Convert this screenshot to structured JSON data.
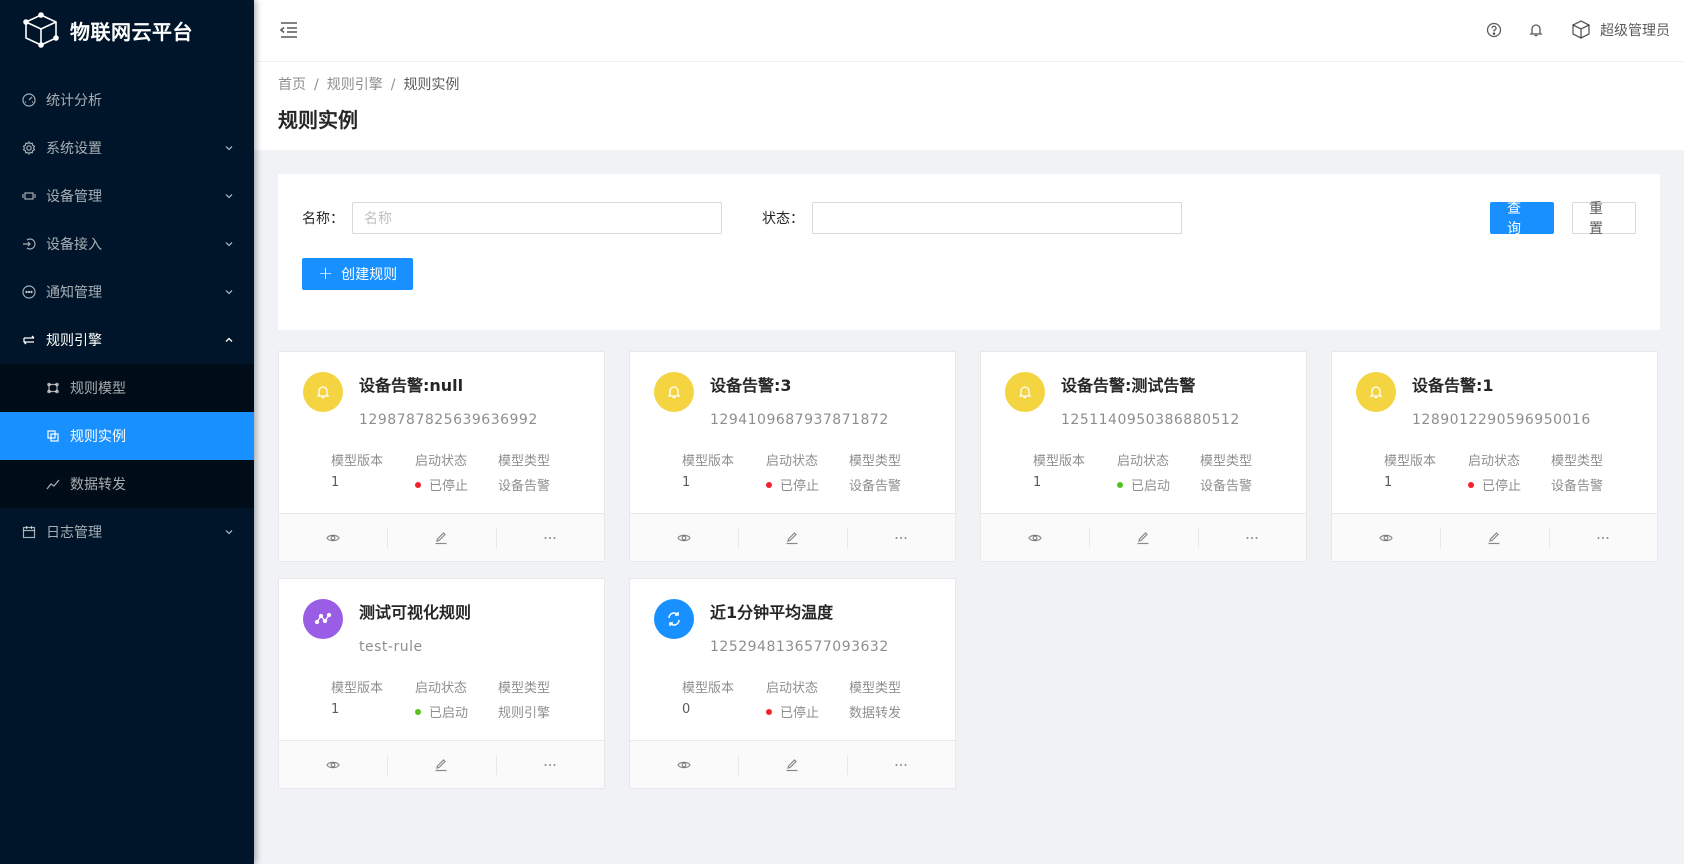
{
  "app": {
    "title": "物联网云平台"
  },
  "sidebar": {
    "items": [
      {
        "label": "统计分析",
        "icon": "dashboard-icon",
        "has_arrow": false
      },
      {
        "label": "系统设置",
        "icon": "setting-icon",
        "has_arrow": true
      },
      {
        "label": "设备管理",
        "icon": "device-icon",
        "has_arrow": true
      },
      {
        "label": "设备接入",
        "icon": "login-icon",
        "has_arrow": true
      },
      {
        "label": "通知管理",
        "icon": "message-icon",
        "has_arrow": true
      },
      {
        "label": "规则引擎",
        "icon": "swap-icon",
        "has_arrow": true,
        "open": true
      },
      {
        "label": "日志管理",
        "icon": "calendar-icon",
        "has_arrow": true
      }
    ],
    "sub_items": [
      {
        "label": "规则模型",
        "icon": "model-icon"
      },
      {
        "label": "规则实例",
        "icon": "instance-icon",
        "active": true
      },
      {
        "label": "数据转发",
        "icon": "line-chart-icon"
      }
    ]
  },
  "header": {
    "user_name": "超级管理员"
  },
  "breadcrumb": {
    "home": "首页",
    "parent": "规则引擎",
    "current": "规则实例",
    "separator": "/"
  },
  "page": {
    "title": "规则实例"
  },
  "filter": {
    "name_label": "名称：",
    "name_placeholder": "名称",
    "status_label": "状态：",
    "query_button": "查 询",
    "reset_button": "重 置",
    "create_button": "创建规则"
  },
  "card_meta_labels": {
    "version": "模型版本",
    "status": "启动状态",
    "type": "模型类型"
  },
  "colors": {
    "primary": "#1890ff",
    "warning_avatar": "#f5d442",
    "purple_avatar": "#9a5ee6",
    "stopped": "#f5222d",
    "started": "#52c41a"
  },
  "cards": [
    {
      "title": "设备告警:null",
      "id": "1298787825639636992",
      "version": "1",
      "status": "已停止",
      "status_kind": "stopped",
      "type": "设备告警",
      "avatar": "bell-icon"
    },
    {
      "title": "设备告警:3",
      "id": "1294109687937871872",
      "version": "1",
      "status": "已停止",
      "status_kind": "stopped",
      "type": "设备告警",
      "avatar": "bell-icon"
    },
    {
      "title": "设备告警:测试告警",
      "id": "1251140950386880512",
      "version": "1",
      "status": "已启动",
      "status_kind": "started",
      "type": "设备告警",
      "avatar": "bell-icon"
    },
    {
      "title": "设备告警:1",
      "id": "1289012290596950016",
      "version": "1",
      "status": "已停止",
      "status_kind": "stopped",
      "type": "设备告警",
      "avatar": "bell-icon"
    },
    {
      "title": "测试可视化规则",
      "id": "test-rule",
      "version": "1",
      "status": "已启动",
      "status_kind": "started",
      "type": "规则引擎",
      "avatar": "node-icon"
    },
    {
      "title": "近1分钟平均温度",
      "id": "1252948136577093632",
      "version": "0",
      "status": "已停止",
      "status_kind": "stopped",
      "type": "数据转发",
      "avatar": "sync-icon"
    }
  ]
}
